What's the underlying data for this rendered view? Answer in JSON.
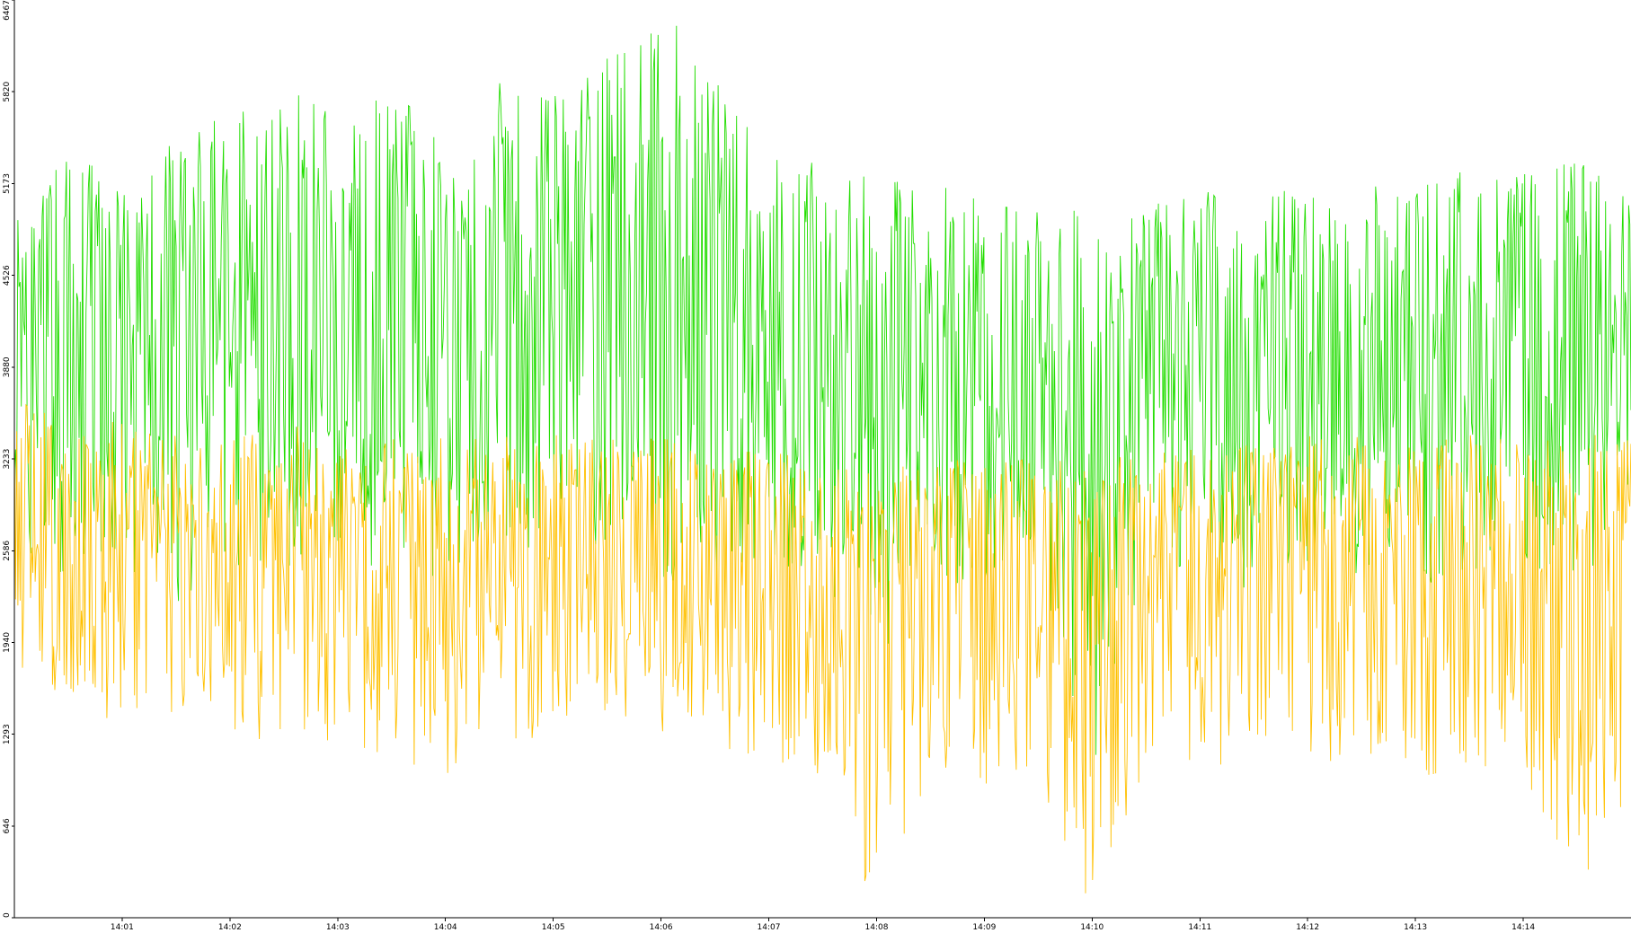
{
  "chart_data": {
    "type": "line",
    "title": "",
    "xlabel": "",
    "ylabel": "",
    "grid": false,
    "legend": "none",
    "x_range": [
      "14:00:00",
      "14:15:00"
    ],
    "ylim": [
      0,
      6467
    ],
    "x_ticks": [
      "14:01",
      "14:02",
      "14:03",
      "14:04",
      "14:05",
      "14:06",
      "14:07",
      "14:08",
      "14:09",
      "14:10",
      "14:11",
      "14:12",
      "14:13",
      "14:14"
    ],
    "y_ticks": [
      "0",
      "646",
      "1293",
      "1940",
      "2586",
      "3233",
      "3880",
      "4526",
      "5173",
      "5820",
      "6467"
    ],
    "series": [
      {
        "color": "#22dd00",
        "x": [
          "14:00:00",
          "14:00:30",
          "14:01:00",
          "14:01:30",
          "14:02:00",
          "14:02:30",
          "14:03:00",
          "14:03:30",
          "14:04:00",
          "14:04:30",
          "14:05:00",
          "14:05:30",
          "14:06:00",
          "14:06:30",
          "14:07:00",
          "14:07:30",
          "14:08:00",
          "14:08:30",
          "14:09:00",
          "14:09:30",
          "14:10:00",
          "14:10:30",
          "14:11:00",
          "14:11:30",
          "14:12:00",
          "14:12:30",
          "14:13:00",
          "14:13:30",
          "14:14:00",
          "14:14:30",
          "14:15:00"
        ],
        "low": [
          2600,
          2350,
          2450,
          2200,
          2500,
          2300,
          2600,
          2400,
          2350,
          2500,
          2700,
          2600,
          2300,
          2400,
          2500,
          2300,
          1800,
          2400,
          2300,
          2500,
          1000,
          2500,
          2400,
          2300,
          2500,
          2400,
          2300,
          2400,
          2500,
          2350,
          2600
        ],
        "high": [
          4900,
          5400,
          5200,
          5500,
          5700,
          5900,
          5700,
          5800,
          5600,
          5900,
          5800,
          6100,
          6467,
          5900,
          5400,
          5300,
          5200,
          5200,
          5100,
          5050,
          4950,
          5000,
          5150,
          5200,
          5100,
          5150,
          5200,
          5300,
          5250,
          5350,
          5100
        ],
        "mean": [
          3800,
          3900,
          3850,
          4000,
          4100,
          4200,
          4150,
          4200,
          4100,
          4250,
          4300,
          4350,
          4300,
          4150,
          3950,
          3850,
          3800,
          3700,
          3750,
          3700,
          3400,
          3650,
          3750,
          3700,
          3700,
          3750,
          3700,
          3750,
          3700,
          3750,
          3700
        ]
      },
      {
        "color": "#ffc000",
        "x": [
          "14:00:00",
          "14:00:30",
          "14:01:00",
          "14:01:30",
          "14:02:00",
          "14:02:30",
          "14:03:00",
          "14:03:30",
          "14:04:00",
          "14:04:30",
          "14:05:00",
          "14:05:30",
          "14:06:00",
          "14:06:30",
          "14:07:00",
          "14:07:30",
          "14:08:00",
          "14:08:30",
          "14:09:00",
          "14:09:30",
          "14:10:00",
          "14:10:30",
          "14:11:00",
          "14:11:30",
          "14:12:00",
          "14:12:30",
          "14:13:00",
          "14:13:30",
          "14:14:00",
          "14:14:30",
          "14:15:00"
        ],
        "low": [
          1800,
          1500,
          1100,
          1300,
          1300,
          1200,
          1200,
          1100,
          1000,
          1200,
          1200,
          1300,
          1300,
          1200,
          1100,
          1000,
          0,
          1000,
          900,
          1000,
          0,
          1100,
          1000,
          1000,
          1050,
          1100,
          1000,
          1000,
          1050,
          0,
          900
        ],
        "high": [
          3700,
          3500,
          3500,
          3400,
          3400,
          3500,
          3400,
          3400,
          3400,
          3400,
          3400,
          3400,
          3400,
          3300,
          3300,
          3250,
          3200,
          3250,
          3200,
          3250,
          3200,
          3300,
          3300,
          3350,
          3400,
          3400,
          3350,
          3400,
          3400,
          3400,
          3450
        ],
        "mean": [
          2700,
          2600,
          2600,
          2550,
          2600,
          2600,
          2550,
          2550,
          2500,
          2600,
          2650,
          2600,
          2600,
          2550,
          2500,
          2450,
          2300,
          2450,
          2400,
          2450,
          2300,
          2500,
          2500,
          2500,
          2550,
          2550,
          2500,
          2500,
          2550,
          2400,
          2500
        ]
      }
    ]
  }
}
